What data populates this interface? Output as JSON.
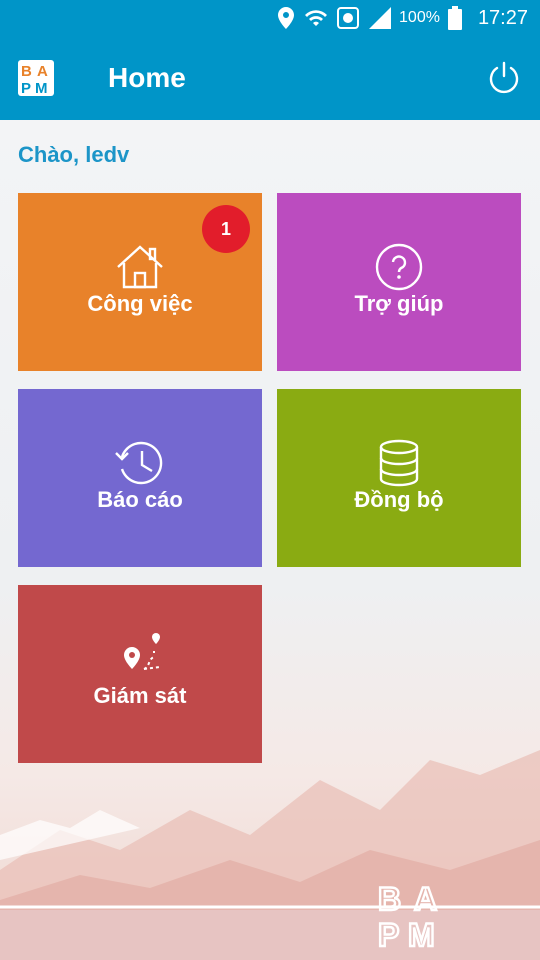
{
  "status_bar": {
    "battery_percent": "100%",
    "time": "17:27",
    "icons": [
      "location-icon",
      "wifi-icon",
      "sync-icon",
      "signal-icon",
      "battery-icon"
    ]
  },
  "app_bar": {
    "logo_text": [
      "B",
      "A",
      "P",
      "M"
    ],
    "title": "Home",
    "power_icon": "power-icon"
  },
  "greeting": "Chào, ledv",
  "tiles": [
    {
      "label": "Công việc",
      "icon": "house-icon",
      "color": "#e8822a",
      "badge": "1"
    },
    {
      "label": "Trợ giúp",
      "icon": "help-icon",
      "color": "#bb4cbf"
    },
    {
      "label": "Báo cáo",
      "icon": "history-icon",
      "color": "#7468d0"
    },
    {
      "label": "Đồng bộ",
      "icon": "database-icon",
      "color": "#8aab12"
    },
    {
      "label": "Giám sát",
      "icon": "route-icon",
      "color": "#c0494a"
    }
  ],
  "accent_color": "#0095c8"
}
